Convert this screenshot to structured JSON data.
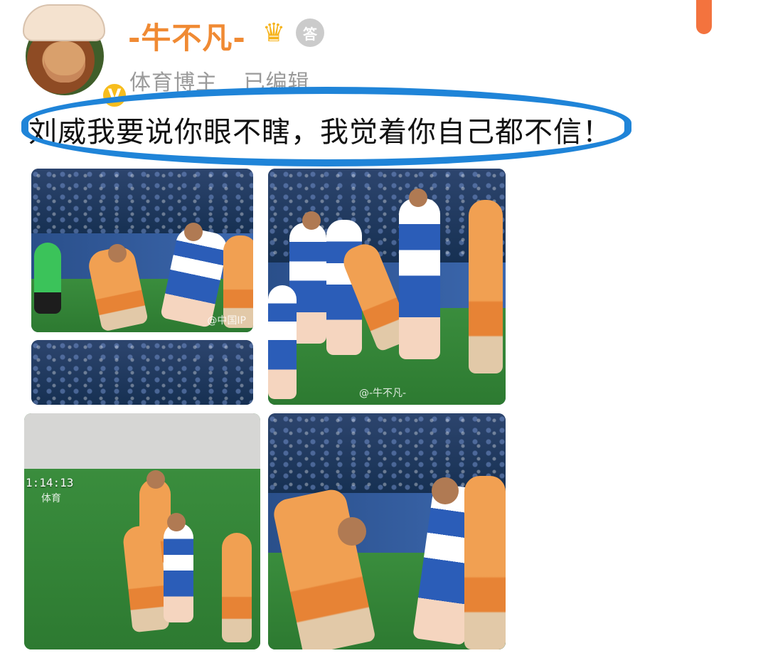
{
  "post": {
    "username": "-牛不凡-",
    "verification": "体育博主",
    "edited": "已编辑",
    "text": "刘威我要说你眼不瞎，我觉着你自己都不信！",
    "badges": {
      "crown": "crown-icon",
      "medal": "medal-icon",
      "verified": "verified-icon"
    },
    "medal_text": "答"
  },
  "images": [
    {
      "name": "photo-top-left",
      "watermark": "@中国IP"
    },
    {
      "name": "photo-crowd-small"
    },
    {
      "name": "photo-top-right",
      "watermark": "@-牛不凡-"
    },
    {
      "name": "photo-bottom-left",
      "channel": "体育",
      "clock": "1:14:13"
    },
    {
      "name": "photo-bottom-right"
    }
  ],
  "colors": {
    "username": "#f08a33",
    "annotation": "#1f84d8",
    "scroll_indicator": "#f3733e"
  }
}
